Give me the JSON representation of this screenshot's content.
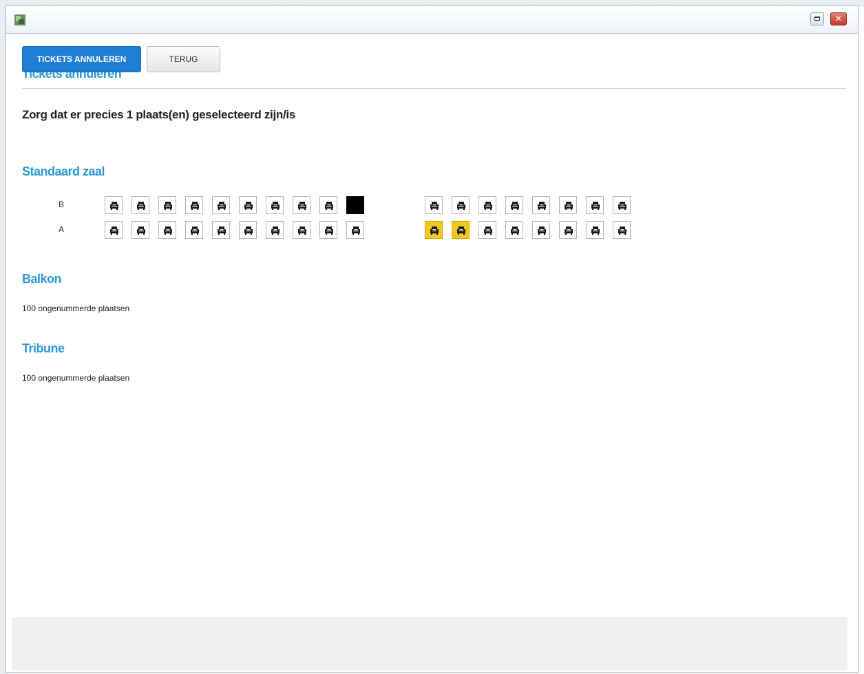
{
  "window": {
    "controls": [
      "maximize-icon",
      "close-icon"
    ]
  },
  "page": {
    "title": "Tickets annuleren",
    "instruction": "Zorg dat er precies 1 plaats(en) geselecteerd zijn/is"
  },
  "halls": {
    "standard": {
      "title": "Standaard zaal",
      "rows": [
        {
          "label": "B",
          "left_block": [
            "free",
            "free",
            "free",
            "free",
            "free",
            "free",
            "free",
            "free",
            "free",
            "occupied"
          ],
          "right_block": [
            "free",
            "free",
            "free",
            "free",
            "free",
            "free",
            "free",
            "free"
          ]
        },
        {
          "label": "A",
          "left_block": [
            "free",
            "free",
            "free",
            "free",
            "free",
            "free",
            "free",
            "free",
            "free",
            "free"
          ],
          "right_block": [
            "selected",
            "selected",
            "free",
            "free",
            "free",
            "free",
            "free",
            "free"
          ]
        }
      ]
    },
    "balkon": {
      "title": "Balkon",
      "text": "100 ongenummerde plaatsen"
    },
    "tribune": {
      "title": "Tribune",
      "text": "100 ongenummerde plaatsen"
    }
  },
  "footer": {
    "cancel_tickets_label": "TICKETS ANNULEREN",
    "back_label": "TERUG"
  },
  "colors": {
    "accent": "#2b9ad8",
    "primary_button": "#1f7fd6",
    "selected_seat": "#f2c81e",
    "occupied_seat": "#000000"
  },
  "icons": {
    "seat": "armchair-icon",
    "app": "app-icon"
  }
}
